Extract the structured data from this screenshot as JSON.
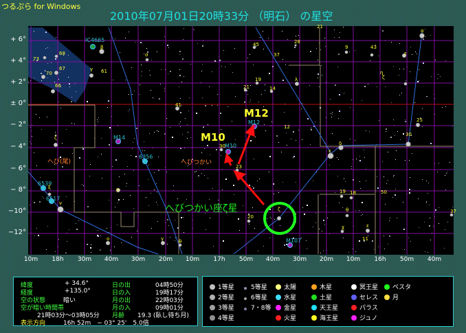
{
  "app_name": "つるぷら for Windows",
  "title": "2010年07月01日20時33分 （明石） の星空",
  "y_axis": [
    "+ 6°",
    "+ 4°",
    "+ 2°",
    "± 0°",
    "− 2°",
    "− 4°",
    "− 6°",
    "− 8°",
    "−10°",
    "−12°"
  ],
  "x_axis": [
    "10m",
    "18h",
    "30m",
    "40m",
    "30m",
    "20m",
    "10m",
    "17h",
    "50m",
    "40m",
    "30m",
    "20m",
    "10m",
    "16h",
    "50m",
    "40m"
  ],
  "map": {
    "annotations": {
      "m12": "M12",
      "m10": "M10",
      "zeta": "へびつかい座ζ星",
      "ophiuchus": "へびつかい",
      "serpens": "へび(尾)"
    },
    "objects": [
      "IC4665",
      "M14",
      "M10",
      "M12",
      "M107",
      "6356",
      "6539",
      "6517"
    ],
    "star_labels": [
      "β",
      "σ",
      "45",
      "37",
      "21",
      "28",
      "9",
      "43",
      "α",
      "ε",
      "73",
      "68",
      "67",
      "70",
      "66",
      "γ",
      "61",
      "41",
      "21",
      "19",
      "14",
      "λ",
      "12",
      "δ",
      "ε",
      "25",
      "30",
      "ζ",
      "ξ",
      "ν",
      "μ",
      "ο",
      "γ",
      "θ",
      "30",
      "23",
      "20",
      "ζ",
      "19",
      "18",
      "50",
      "θ",
      "χ",
      "ε",
      "11",
      "37",
      "η",
      "ζ"
    ]
  },
  "info": {
    "lat_label": "緯度",
    "lat": "+   34.6°",
    "lon_label": "経度",
    "lon": "+135.0°",
    "sky_label": "空の状態",
    "sky": "暗い",
    "dark_label": "空が暗い時間帯",
    "dark": "21時03分〜03時05分",
    "sunrise_label": "日の出",
    "sunrise": "04時50分",
    "sunset_label": "日の入",
    "sunset": "19時17分",
    "moonrise_label": "月の出",
    "moonrise": "22時03分",
    "moonset_label": "月の入",
    "moonset": "09時01分",
    "moonage_label": "月齢",
    "moonage": "19.3 (臥し待ち月)",
    "dir_label": "表示方向",
    "dir": "16h 52m　− 03° 25'　5.0倍"
  },
  "legend": [
    {
      "label": "1等星",
      "color": "#c0c0c0"
    },
    {
      "label": "2等星",
      "color": "#b0b0b0"
    },
    {
      "label": "3等星",
      "color": "#a0a0a0"
    },
    {
      "label": "4等星",
      "color": "#909090"
    },
    {
      "label": "5等星",
      "color": "#9090b0"
    },
    {
      "label": "6等星",
      "color": "#a0a0a0"
    },
    {
      "label": "7・8等",
      "color": "#8080a0"
    },
    {
      "label": "太陽",
      "color": "#ffff80"
    },
    {
      "label": "水星",
      "color": "#40e0ff"
    },
    {
      "label": "金星",
      "color": "#ff20ff"
    },
    {
      "label": "火星",
      "color": "#ff2020"
    },
    {
      "label": "木星",
      "color": "#ffa020"
    },
    {
      "label": "土星",
      "color": "#20e020"
    },
    {
      "label": "天王星",
      "color": "#20e0ff"
    },
    {
      "label": "海王星",
      "color": "#ffff20"
    },
    {
      "label": "冥王星",
      "color": "#ffffff"
    },
    {
      "label": "セレス",
      "color": "#6060ff"
    },
    {
      "label": "パラス",
      "color": "#ff2020"
    },
    {
      "label": "ジュノ",
      "color": "#ff20ff"
    },
    {
      "label": "ベスタ",
      "color": "#20ff20"
    },
    {
      "label": "月",
      "color": "#ffe040"
    }
  ]
}
